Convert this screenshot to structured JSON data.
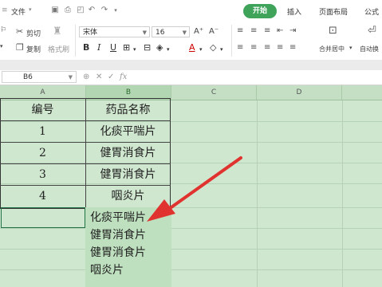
{
  "menu": {
    "file_label": "文件",
    "tabs": [
      {
        "label": "开始",
        "active": true
      },
      {
        "label": "插入",
        "active": false
      },
      {
        "label": "页面布局",
        "active": false
      },
      {
        "label": "公式",
        "active": false
      }
    ]
  },
  "ribbon": {
    "cut_label": "剪切",
    "copy_label": "复制",
    "format_painter_label": "格式刷",
    "font_name": "宋体",
    "font_size": "16",
    "merge_label": "合并居中",
    "autowrap_label": "自动换"
  },
  "formula_bar": {
    "cell_ref": "B6",
    "fx_label": "fx",
    "value": ""
  },
  "grid": {
    "columns": [
      "A",
      "B",
      "C",
      "D"
    ],
    "rows": [
      [
        "编号",
        "药品名称"
      ],
      [
        "1",
        "化痰平喘片"
      ],
      [
        "2",
        "健胃消食片"
      ],
      [
        "3",
        "健胃消食片"
      ],
      [
        "4",
        "咽炎片"
      ]
    ],
    "overflow_lines": [
      "化痰平喘片",
      "健胃消食片",
      "健胃消食片",
      "咽炎片"
    ]
  },
  "colors": {
    "accent": "#3fa35a",
    "grid_bg": "#cfe6cf",
    "arrow": "#e0322e"
  }
}
